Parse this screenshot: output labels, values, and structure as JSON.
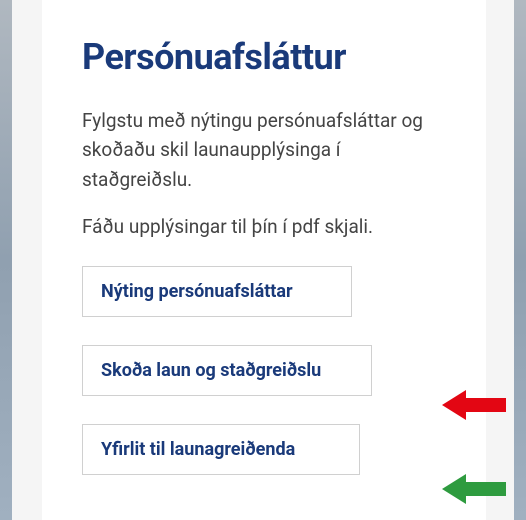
{
  "heading": "Persónuafsláttur",
  "paragraph1": "Fylgstu með nýtingu persónuafsláttar og skoðaðu skil launaupplýsinga í staðgreiðslu.",
  "paragraph2": "Fáðu upplýsingar til þín í pdf skjali.",
  "buttons": {
    "b1": "Nýting persónuafsláttar",
    "b2": "Skoða laun og staðgreiðslu",
    "b3": "Yfirlit til launagreiðenda"
  },
  "arrows": {
    "red": "#e30613",
    "green": "#2e9b3f"
  }
}
